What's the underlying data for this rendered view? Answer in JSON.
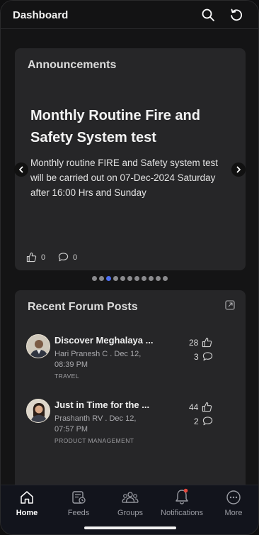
{
  "header": {
    "title": "Dashboard"
  },
  "announcements": {
    "section_title": "Announcements",
    "headline": "Monthly Routine Fire and Safety System test",
    "body": "Monthly routine FIRE and Safety system test will be carried out on 07-Dec-2024 Saturday after 16:00 Hrs and Sunday",
    "likes": "0",
    "comments": "0",
    "carousel_pages": 11,
    "carousel_active": 2
  },
  "forum": {
    "section_title": "Recent Forum Posts",
    "posts": [
      {
        "title": "Discover Meghalaya ...",
        "author": "Hari Pranesh C",
        "date": "Dec 12, 08:39 PM",
        "tag": "TRAVEL",
        "likes": "28",
        "comments": "3"
      },
      {
        "title": "Just in Time for the ...",
        "author": "Prashanth RV",
        "date": "Dec 12, 07:57 PM",
        "tag": "PRODUCT MANAGEMENT",
        "likes": "44",
        "comments": "2"
      }
    ]
  },
  "bottom_nav": {
    "tabs": [
      {
        "label": "Home",
        "icon": "home-icon",
        "active": true
      },
      {
        "label": "Feeds",
        "icon": "feeds-icon",
        "active": false
      },
      {
        "label": "Groups",
        "icon": "groups-icon",
        "active": false
      },
      {
        "label": "Notifications",
        "icon": "bell-icon",
        "active": false,
        "badge": true
      },
      {
        "label": "More",
        "icon": "more-icon",
        "active": false
      }
    ]
  },
  "colors": {
    "accent": "#4b6ef0",
    "badge": "#e5483d",
    "card": "#262628",
    "background": "#141415"
  }
}
